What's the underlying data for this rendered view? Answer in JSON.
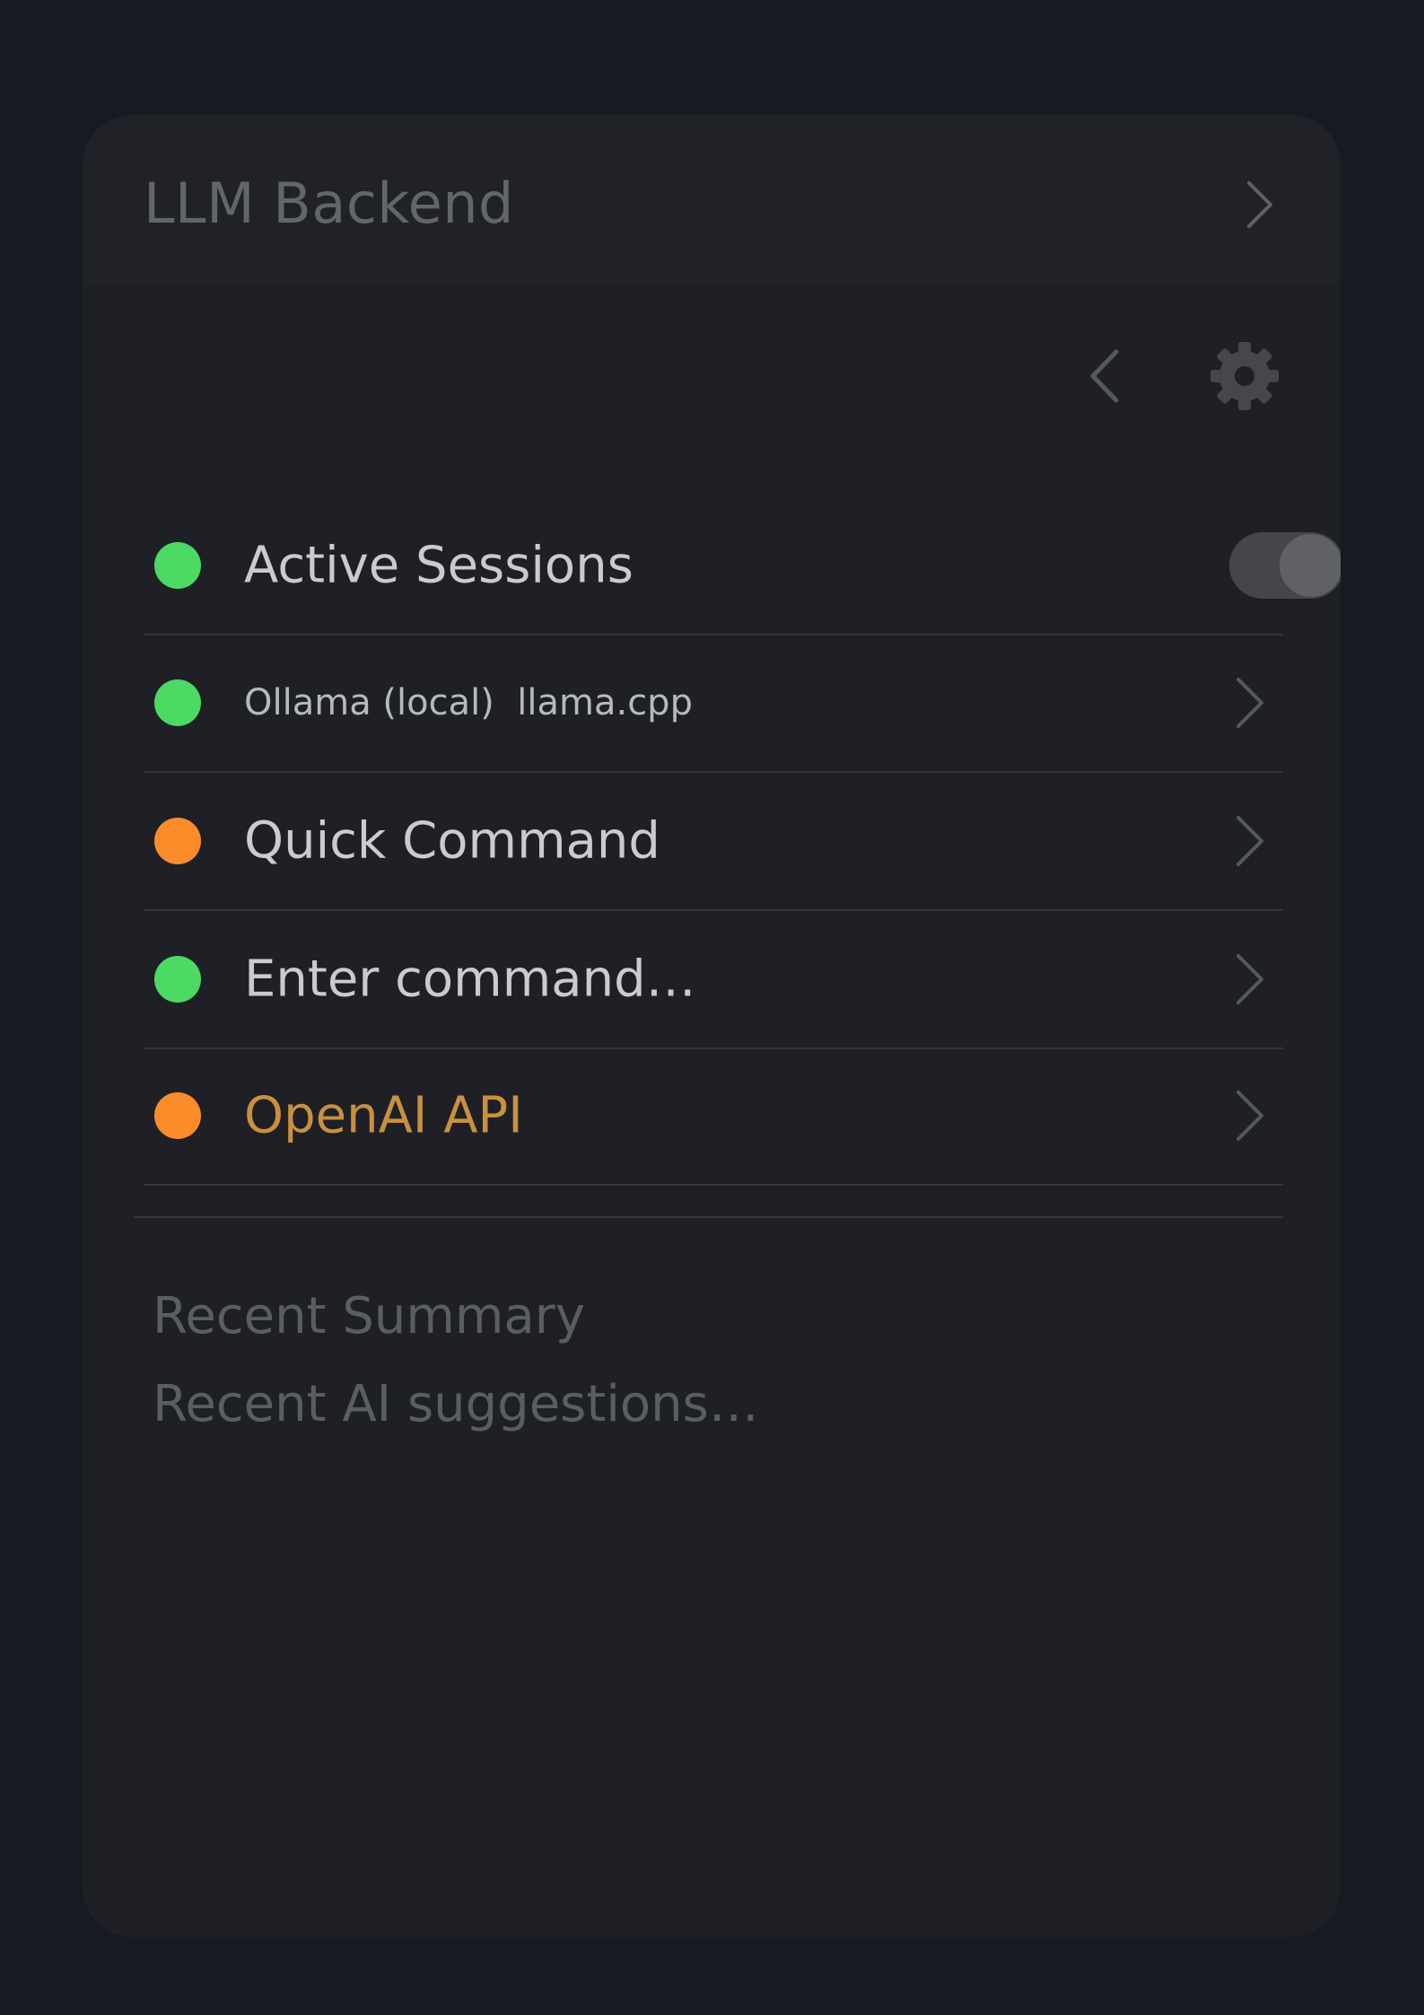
{
  "header": {
    "title": "LLM Backend"
  },
  "toolbar": {
    "back_icon": "chevron-left-icon",
    "settings_icon": "gear-icon"
  },
  "rows": [
    {
      "label": "Active Sessions",
      "status": "green",
      "control": "toggle",
      "toggle_on": true
    },
    {
      "label": "Ollama (local)  llama.cpp",
      "status": "green",
      "control": "chevron"
    },
    {
      "label": "Quick Command",
      "status": "orange",
      "control": "chevron"
    },
    {
      "label": "Enter command…",
      "status": "green",
      "control": "chevron"
    },
    {
      "label": "OpenAI API",
      "status": "orange",
      "control": "chevron"
    }
  ],
  "summary": {
    "title": "Recent Summary",
    "text": "Recent AI suggestions…"
  },
  "colors": {
    "status_green": "#4cd964",
    "status_orange": "#fb8c2a",
    "accent_text": "#c8903f",
    "background": "#161a22",
    "card": "#1e2026"
  }
}
